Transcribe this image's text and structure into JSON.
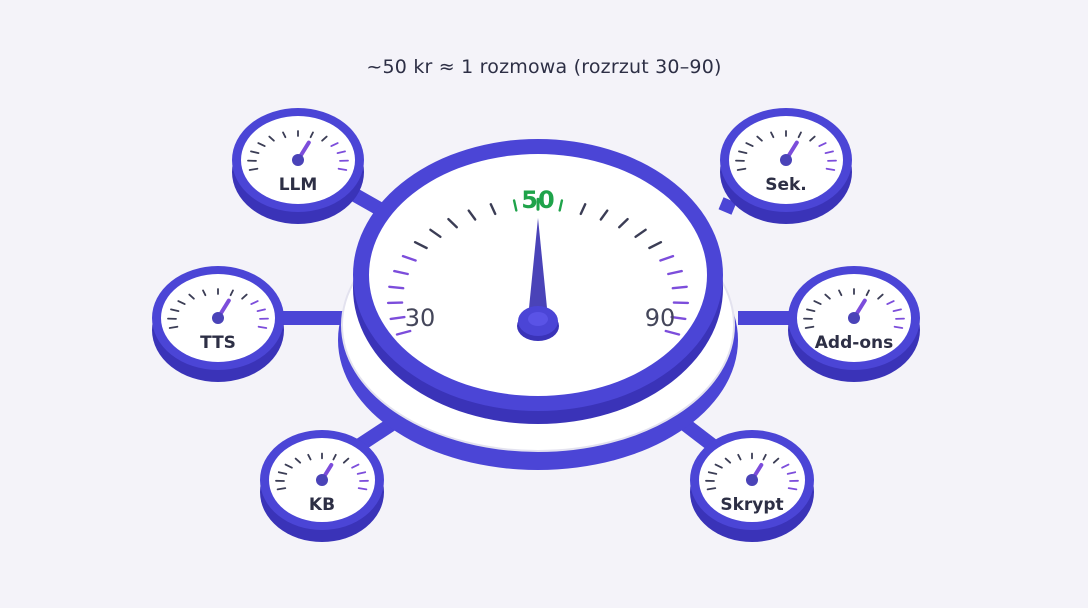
{
  "caption": "~50 kr ≈ 1 rozmowa (rozrzut 30–90)",
  "main_gauge": {
    "center_label": "50",
    "min_label": "30",
    "max_label": "90",
    "value": 50,
    "min": 30,
    "max": 90
  },
  "small_gauges": [
    {
      "id": "llm",
      "label": "LLM",
      "level": 0.6
    },
    {
      "id": "sek",
      "label": "Sek.",
      "level": 0.6
    },
    {
      "id": "tts",
      "label": "TTS",
      "level": 0.6
    },
    {
      "id": "addons",
      "label": "Add-ons",
      "level": 0.6
    },
    {
      "id": "kb",
      "label": "KB",
      "level": 0.6
    },
    {
      "id": "skrypt",
      "label": "Skrypt",
      "level": 0.6
    }
  ],
  "colors": {
    "rim": "#4b45d6",
    "rim_dark": "#3a33b8",
    "face": "#ffffff",
    "tick": "#3b3d55",
    "tick_accent": "#7c4ddb",
    "needle": "#4a43b8",
    "highlight": "#1fa34a",
    "label": "#2d2f45",
    "background": "#f4f3f9"
  }
}
